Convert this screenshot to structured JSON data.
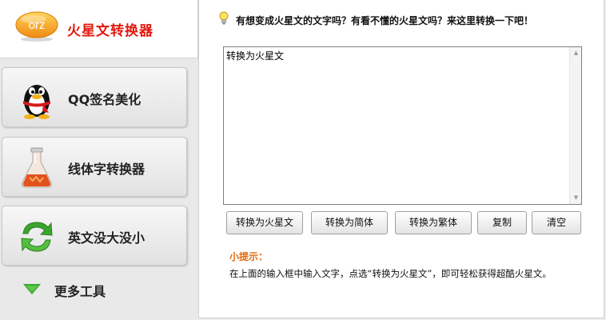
{
  "sidebar": {
    "logo_badge_text": "orz",
    "title": "火星文转换器",
    "items": [
      {
        "label": "QQ签名美化",
        "icon": "penguin-icon"
      },
      {
        "label": "线体字转换器",
        "icon": "flask-icon"
      },
      {
        "label": "英文没大没小",
        "icon": "refresh-arrows-icon"
      }
    ],
    "more_label": "更多工具",
    "more_icon": "down-triangle-icon"
  },
  "main": {
    "headline": "有想变成火星文的文字吗？有看不懂的火星文吗？来这里转换一下吧！",
    "headline_icon": "lightbulb-icon",
    "textarea_value": "转换为火星文",
    "buttons": {
      "to_martian": "转换为火星文",
      "to_simplified": "转换为简体",
      "to_traditional": "转换为繁体",
      "copy": "复制",
      "clear": "清空"
    },
    "tip_title": "小提示：",
    "tip_text": "在上面的输入框中输入文字，点选“转换为火星文”，即可轻松获得超酷火星文。"
  },
  "colors": {
    "title_red": "#e3170d",
    "tip_orange": "#e06a10",
    "logo_orange": "#f39a1e",
    "arrow_green": "#3aa52e"
  }
}
